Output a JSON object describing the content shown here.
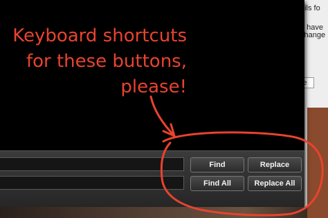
{
  "background_window": {
    "fragment_1": "ails fo",
    "fragment_2": "u have",
    "fragment_3": "change",
    "fragment_4": "e"
  },
  "find_panel": {
    "find_label": "Find",
    "replace_label": "Replace",
    "find_all_label": "Find All",
    "replace_all_label": "Replace All"
  },
  "annotation": {
    "line_1": "Keyboard shortcuts",
    "line_2": "for these buttons,",
    "line_3": "please!",
    "color": "#e8432f"
  }
}
